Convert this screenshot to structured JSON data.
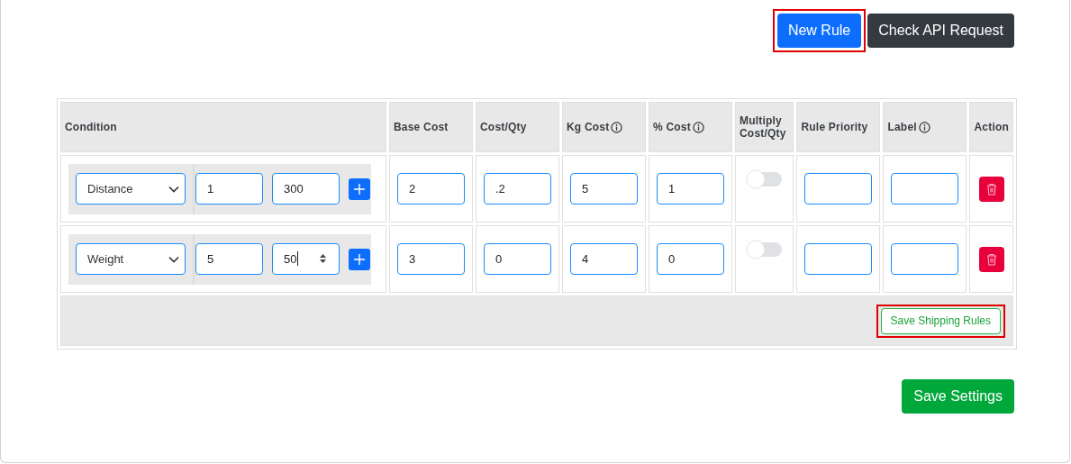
{
  "actions": [
    {
      "label": "New Rule",
      "kind": "primary",
      "highlighted": true
    },
    {
      "label": "Check API Request",
      "kind": "dark",
      "highlighted": false
    }
  ],
  "table": {
    "columns": [
      {
        "label": "Condition",
        "info": false
      },
      {
        "label": "Base Cost",
        "info": false
      },
      {
        "label": "Cost/Qty",
        "info": false
      },
      {
        "label": "Kg Cost",
        "info": true
      },
      {
        "label": "% Cost",
        "info": true
      },
      {
        "label": "Multiply Cost/Qty",
        "info": false
      },
      {
        "label": "Rule Priority",
        "info": false
      },
      {
        "label": "Label",
        "info": true
      },
      {
        "label": "Action",
        "info": false
      }
    ],
    "rows": [
      {
        "condition": {
          "type": "Distance",
          "min": "1",
          "max": "300",
          "max_focused": false
        },
        "base_cost": "2",
        "cost_qty": ".2",
        "kg_cost": "5",
        "pct_cost": "1",
        "multiply": {
          "on": false
        }
      },
      {
        "condition": {
          "type": "Weight",
          "min": "5",
          "max": "50",
          "max_focused": true
        },
        "base_cost": "3",
        "cost_qty": "0",
        "kg_cost": "4",
        "pct_cost": "0",
        "multiply": {
          "on": false
        }
      }
    ],
    "footer_button": {
      "label": "Save Shipping Rules",
      "highlighted": true
    }
  },
  "save_button": {
    "label": "Save Settings"
  }
}
